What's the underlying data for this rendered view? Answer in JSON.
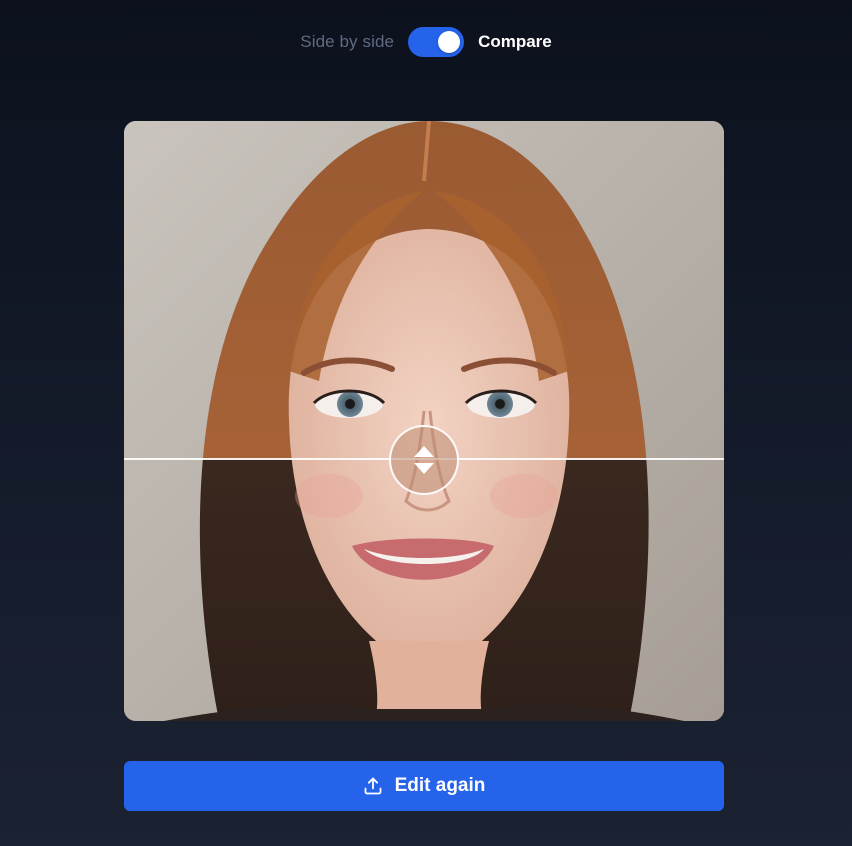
{
  "toggle": {
    "off_label": "Side by side",
    "on_label": "Compare",
    "state": "on"
  },
  "compare": {
    "split_position": 0.56,
    "handle_icon": "vertical-resize-arrows-icon"
  },
  "actions": {
    "edit_again_label": "Edit again",
    "edit_again_icon": "upload-icon"
  },
  "colors": {
    "accent": "#2563eb",
    "background_top": "#0c111d",
    "background_bottom": "#1b2232",
    "muted_text": "#5f6b80"
  }
}
